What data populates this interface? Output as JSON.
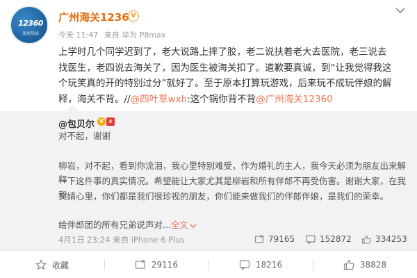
{
  "post": {
    "author": "广州海关12360",
    "verified_label": "V",
    "avatar_text": "12360",
    "avatar_sub": "海关热线",
    "time": "今天 11:47",
    "source": "来自 华为 P8max",
    "body_line1": "上学时几个同学迟到了，老大说路上摔了胶，老二说扶着老大去医院，老三说去",
    "body_line2": "找医生，老四说去海关了，因为医生被海关扣了。道歉要真诚，到“让我觉得我这",
    "body_line3": "个玩笑真的开的特别过分”就好了。至于原本打算玩游戏，后来玩不成玩伴娘的解",
    "body_line4a": "释，海关不背。//",
    "body_mention1": "@四叶草wxh",
    "body_line4b": ":这个锅你背不背",
    "body_mention2": "@广州海关12360"
  },
  "repost": {
    "author": "@包贝尔",
    "badge_v": "V",
    "badge_crown": "♛",
    "line1": "对不起，谢谢",
    "line2": "柳岩，对不起，看到你流泪，我心里特别难受，作为婚礼的主人，我今天必须为朋友出来解释",
    "line3": "一下这件事的真实情况。希望能让大家尤其是柳岩和所有伴郎不再受伤害。谢谢大家，在我和",
    "line4": "文婧心里，你们都是我们很珍视的朋友，你们能来做我们的伴郎伴娘，是我们的荣幸。",
    "line5": "给伴郎团的所有兄弟说声对...",
    "expand_label": "全文",
    "expand_icon": "chevron-down-icon",
    "time": "4月1日 23:24 来自 iPhone 6 Plus",
    "repost_count": "79165",
    "comment_count": "152872",
    "like_count": "334253"
  },
  "actions": {
    "favorite_label": "收藏",
    "repost_count": "29116",
    "comment_count": "18216",
    "like_count": "38828"
  },
  "colors": {
    "author": "#e46d0e",
    "mention": "#eb7350",
    "repost_bg": "#f2f2f5"
  }
}
